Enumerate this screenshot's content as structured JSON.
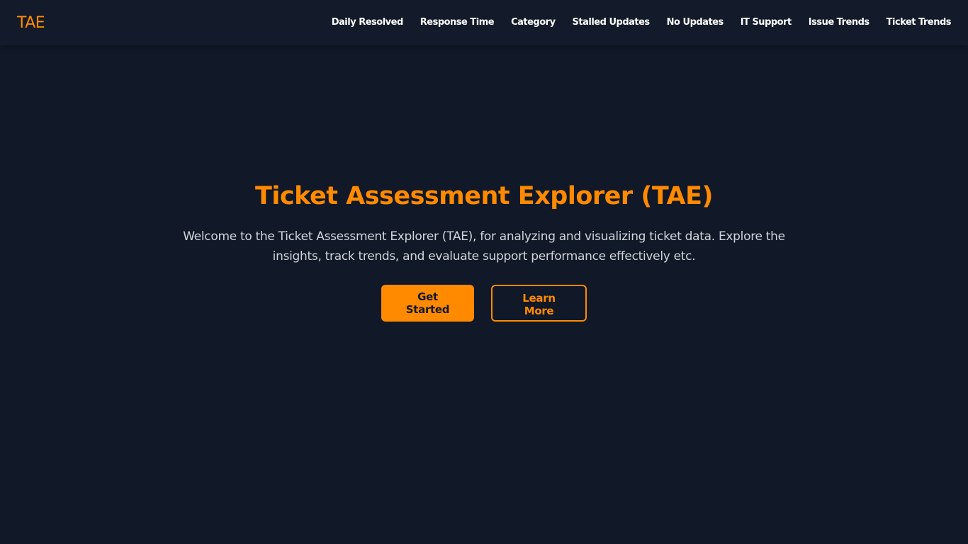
{
  "brand": "TAE",
  "nav": {
    "items": [
      {
        "label": "Daily Resolved"
      },
      {
        "label": "Response Time"
      },
      {
        "label": "Category"
      },
      {
        "label": "Stalled Updates"
      },
      {
        "label": "No Updates"
      },
      {
        "label": "IT Support"
      },
      {
        "label": "Issue Trends"
      },
      {
        "label": "Ticket Trends"
      }
    ]
  },
  "hero": {
    "title": "Ticket Assessment Explorer (TAE)",
    "description": "Welcome to the Ticket Assessment Explorer (TAE), for analyzing and visualizing ticket data. Explore the insights, track trends, and evaluate support performance effectively etc.",
    "primary_button": "Get Started",
    "secondary_button": "Learn More"
  },
  "colors": {
    "background": "#111827",
    "navbar": "#131a2a",
    "accent": "#ff8a00",
    "text": "#ffffff",
    "muted_text": "#d1d5db"
  }
}
